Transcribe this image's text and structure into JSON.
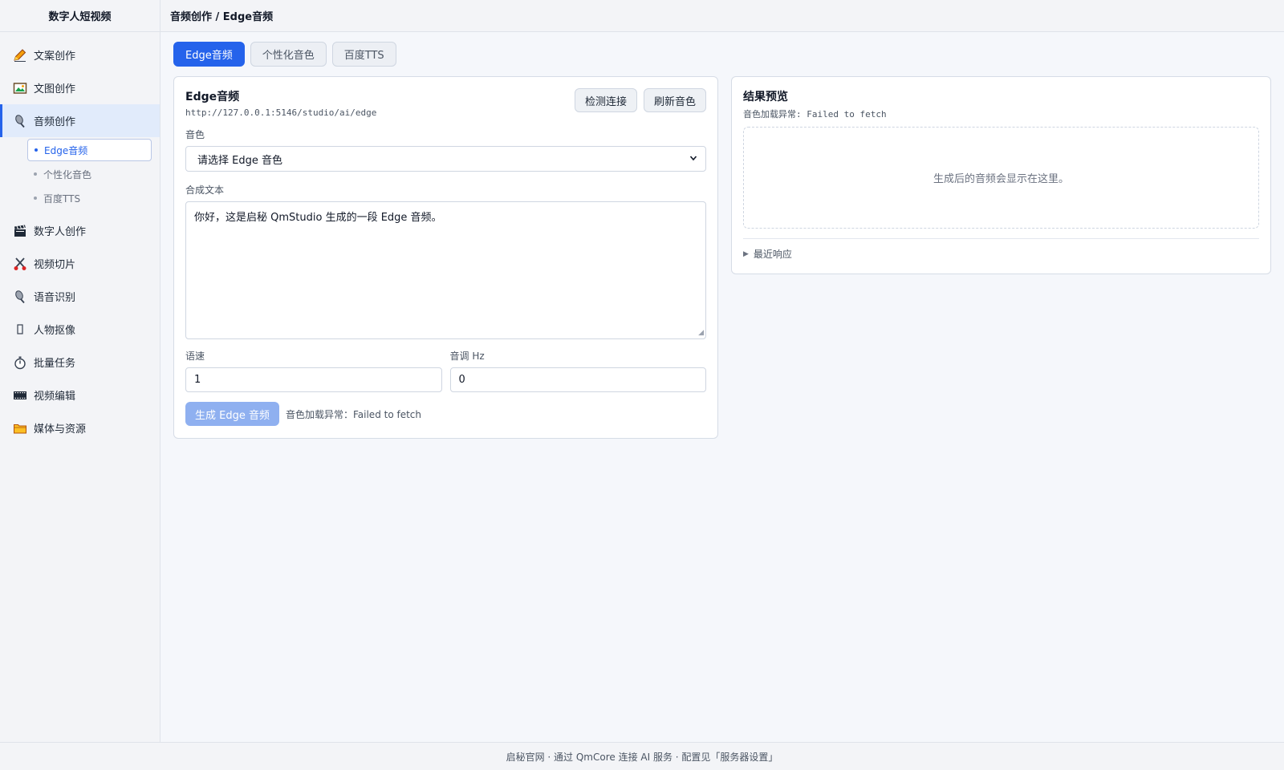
{
  "app": {
    "title": "数字人短视频"
  },
  "breadcrumb": "音频创作 / Edge音频",
  "sidebar": {
    "items": [
      {
        "label": "文案创作",
        "icon": "pencil-icon"
      },
      {
        "label": "文图创作",
        "icon": "picture-icon"
      },
      {
        "label": "音频创作",
        "icon": "microphone-icon"
      },
      {
        "label": "数字人创作",
        "icon": "clapper-icon"
      },
      {
        "label": "视频切片",
        "icon": "scissors-icon"
      },
      {
        "label": "语音识别",
        "icon": "microphone-icon"
      },
      {
        "label": "人物抠像",
        "icon": "person-icon"
      },
      {
        "label": "批量任务",
        "icon": "stopwatch-icon"
      },
      {
        "label": "视频编辑",
        "icon": "film-icon"
      },
      {
        "label": "媒体与资源",
        "icon": "folder-icon"
      }
    ],
    "sub_items": [
      "Edge音频",
      "个性化音色",
      "百度TTS"
    ]
  },
  "tabs": [
    "Edge音频",
    "个性化音色",
    "百度TTS"
  ],
  "form": {
    "title": "Edge音频",
    "endpoint": "http://127.0.0.1:5146/studio/ai/edge",
    "check_button": "检测连接",
    "refresh_button": "刷新音色",
    "voice_label": "音色",
    "voice_selected": "请选择 Edge 音色",
    "text_label": "合成文本",
    "text_value": "你好，这是启秘 QmStudio 生成的一段 Edge 音频。",
    "speed_label": "语速",
    "speed_value": "1",
    "pitch_label": "音调 Hz",
    "pitch_value": "0",
    "submit_button": "生成 Edge 音频",
    "status": "音色加载异常：Failed to fetch"
  },
  "preview": {
    "title": "结果预览",
    "status": "音色加载异常: Failed to fetch",
    "placeholder": "生成后的音频会显示在这里。",
    "details_label": "最近响应"
  },
  "footer": "启秘官网 · 通过 QmCore 连接 AI 服务 · 配置见「服务器设置」",
  "colors": {
    "accent": "#2563eb",
    "primary_disabled": "#8fb0f0"
  }
}
